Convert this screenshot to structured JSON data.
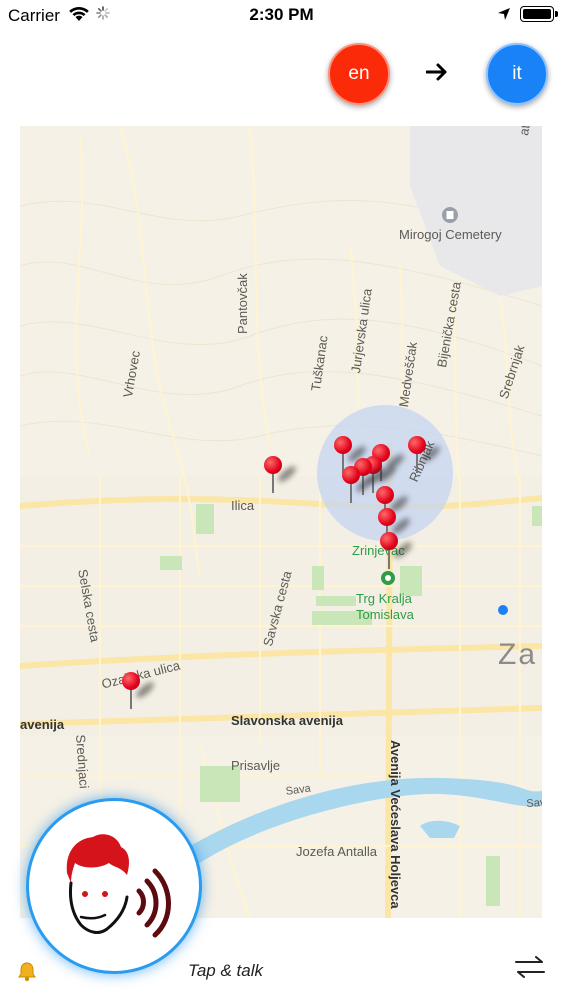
{
  "status_bar": {
    "carrier": "Carrier",
    "time": "2:30 PM"
  },
  "languages": {
    "source": "en",
    "target": "it",
    "source_color": "#fb2a08",
    "target_color": "#1a82f7"
  },
  "map": {
    "labels": {
      "mirogoj": "Mirogoj Cemetery",
      "pantovcak": "Pantovčak",
      "jurjevska": "Jurjevska ulica",
      "tuskanac": "Tuškanac",
      "medvescak": "Medveščak",
      "bijenicka": "Bijenička cesta",
      "srebrnjak": "Srebrnjak",
      "vrhovec": "Vrhovec",
      "ribnjak": "Ribnjak",
      "ilica": "Ilica",
      "zrinjevac": "Zrinjevac",
      "trg_kralja": "Trg Kralja",
      "tomislava": "Tomislava",
      "selska": "Selska cesta",
      "savska": "Savska cesta",
      "zagreb_partial": "Za",
      "ozaljska": "Ozaljska ulica",
      "slavonska": "Slavonska avenija",
      "avenija_left": "avenija",
      "sredjaci": "Srednjaci",
      "prisavlje": "Prisavlje",
      "sava": "Sava",
      "avenija_vecesl": "Avenija Većeslava Holjevca",
      "jozefa": "Jozefa Antalla",
      "sava_right": "Sava",
      "ate": "ate"
    }
  },
  "bottom_bar": {
    "tap_talk": "Tap & talk"
  },
  "icons": {
    "wifi": "wifi-icon",
    "spinner": "activity-spinner-icon",
    "location": "location-arrow-icon",
    "battery": "battery-icon",
    "arrow": "arrow-right-icon",
    "bell": "bell-icon",
    "swap": "swap-arrows-icon",
    "talk": "speaking-head-icon"
  }
}
